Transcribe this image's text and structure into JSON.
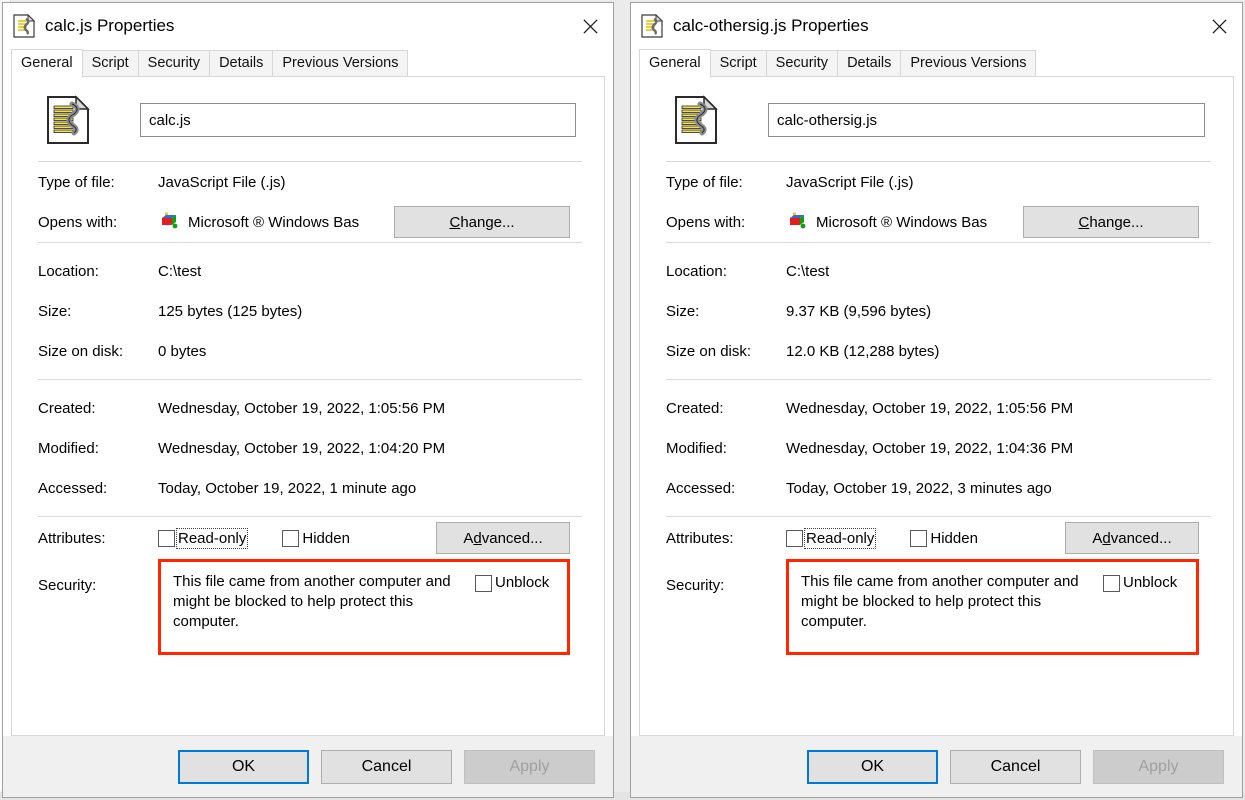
{
  "windows": [
    {
      "title": "calc.js Properties",
      "title_icon": "javascript-file-icon",
      "close_icon": "close-icon",
      "tabs": [
        {
          "label": "General",
          "active": true
        },
        {
          "label": "Script",
          "active": false
        },
        {
          "label": "Security",
          "active": false
        },
        {
          "label": "Details",
          "active": false
        },
        {
          "label": "Previous Versions",
          "active": false
        }
      ],
      "filename_value": "calc.js",
      "fields": {
        "type_of_file_label": "Type of file:",
        "type_of_file_value": "JavaScript File (.js)",
        "opens_with_label": "Opens with:",
        "opens_with_value": "Microsoft ® Windows Bas",
        "change_button": "Change...",
        "location_label": "Location:",
        "location_value": "C:\\test",
        "size_label": "Size:",
        "size_value": "125 bytes (125 bytes)",
        "size_on_disk_label": "Size on disk:",
        "size_on_disk_value": "0 bytes",
        "created_label": "Created:",
        "created_value": "Wednesday, October 19, 2022, 1:05:56 PM",
        "modified_label": "Modified:",
        "modified_value": "Wednesday, October 19, 2022, 1:04:20 PM",
        "accessed_label": "Accessed:",
        "accessed_value": "Today, October 19, 2022, 1 minute ago",
        "attributes_label": "Attributes:",
        "readonly_label": "Read-only",
        "hidden_label": "Hidden",
        "advanced_button": "Advanced...",
        "security_label": "Security:",
        "security_text": "This file came from another computer and might be blocked to help protect this computer.",
        "unblock_label": "Unblock"
      },
      "footer": {
        "ok": "OK",
        "cancel": "Cancel",
        "apply": "Apply"
      }
    },
    {
      "title": "calc-othersig.js Properties",
      "title_icon": "javascript-file-icon",
      "close_icon": "close-icon",
      "tabs": [
        {
          "label": "General",
          "active": true
        },
        {
          "label": "Script",
          "active": false
        },
        {
          "label": "Security",
          "active": false
        },
        {
          "label": "Details",
          "active": false
        },
        {
          "label": "Previous Versions",
          "active": false
        }
      ],
      "filename_value": "calc-othersig.js",
      "fields": {
        "type_of_file_label": "Type of file:",
        "type_of_file_value": "JavaScript File (.js)",
        "opens_with_label": "Opens with:",
        "opens_with_value": "Microsoft ® Windows Bas",
        "change_button": "Change...",
        "location_label": "Location:",
        "location_value": "C:\\test",
        "size_label": "Size:",
        "size_value": "9.37 KB (9,596 bytes)",
        "size_on_disk_label": "Size on disk:",
        "size_on_disk_value": "12.0 KB (12,288 bytes)",
        "created_label": "Created:",
        "created_value": "Wednesday, October 19, 2022, 1:05:56 PM",
        "modified_label": "Modified:",
        "modified_value": "Wednesday, October 19, 2022, 1:04:36 PM",
        "accessed_label": "Accessed:",
        "accessed_value": "Today, October 19, 2022, 3 minutes ago",
        "attributes_label": "Attributes:",
        "readonly_label": "Read-only",
        "hidden_label": "Hidden",
        "advanced_button": "Advanced...",
        "security_label": "Security:",
        "security_text": "This file came from another computer and might be blocked to help protect this computer.",
        "unblock_label": "Unblock"
      },
      "footer": {
        "ok": "OK",
        "cancel": "Cancel",
        "apply": "Apply"
      }
    }
  ],
  "colors": {
    "highlight_box": "#ff2600",
    "default_button_focus": "#0078d7"
  }
}
